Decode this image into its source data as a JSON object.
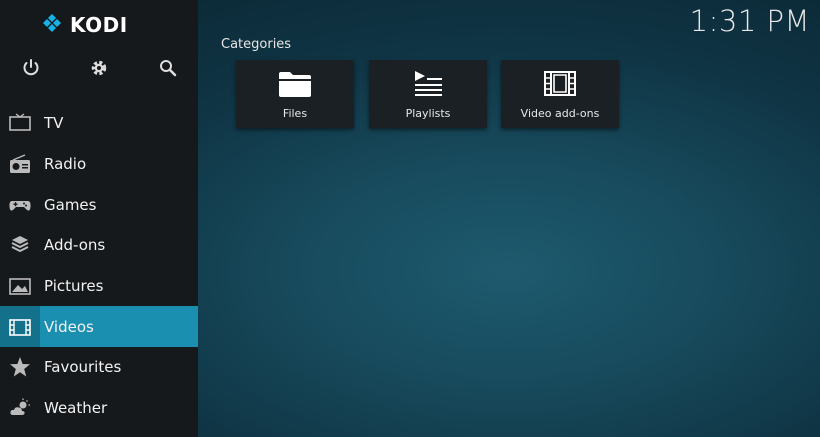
{
  "app": {
    "name": "KODI"
  },
  "clock": "1:31 PM",
  "top_icons": [
    "power-icon",
    "gear-icon",
    "search-icon"
  ],
  "menu": [
    {
      "label": "TV",
      "icon": "tv-icon"
    },
    {
      "label": "Radio",
      "icon": "radio-icon"
    },
    {
      "label": "Games",
      "icon": "gamepad-icon"
    },
    {
      "label": "Add-ons",
      "icon": "box-icon"
    },
    {
      "label": "Pictures",
      "icon": "picture-icon"
    },
    {
      "label": "Videos",
      "icon": "film-icon",
      "active": true
    },
    {
      "label": "Favourites",
      "icon": "star-icon"
    },
    {
      "label": "Weather",
      "icon": "weather-icon"
    }
  ],
  "categories": {
    "title": "Categories",
    "tiles": [
      {
        "label": "Files",
        "icon": "folder-icon"
      },
      {
        "label": "Playlists",
        "icon": "playlist-icon"
      },
      {
        "label": "Video add-ons",
        "icon": "film-icon"
      }
    ]
  },
  "colors": {
    "accent": "#1a8fb0",
    "sidebar": "#16191c"
  }
}
